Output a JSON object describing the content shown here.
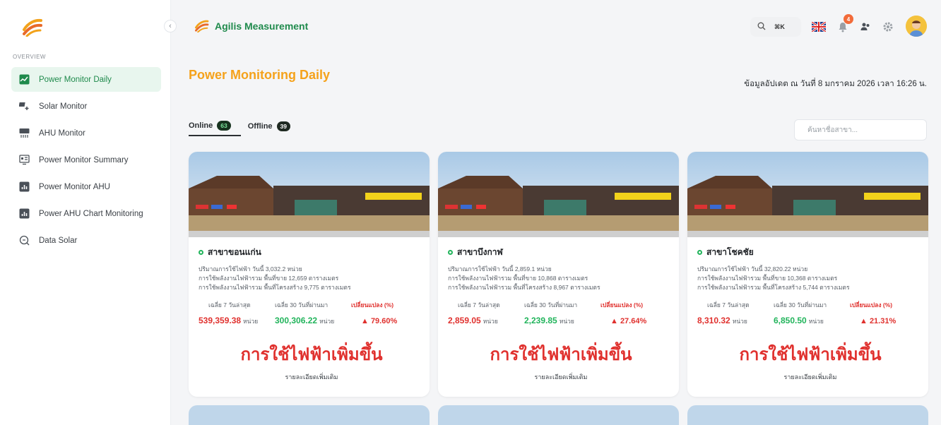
{
  "sidebar": {
    "section": "OVERVIEW",
    "items": [
      {
        "label": "Power Monitor Daily",
        "icon": "chart-icon",
        "active": true
      },
      {
        "label": "Solar Monitor",
        "icon": "solar-icon"
      },
      {
        "label": "AHU Monitor",
        "icon": "ac-icon"
      },
      {
        "label": "Power Monitor Summary",
        "icon": "summary-icon"
      },
      {
        "label": "Power Monitor AHU",
        "icon": "bar-chart-icon"
      },
      {
        "label": "Power AHU Chart Monitoring",
        "icon": "bar-chart-icon"
      },
      {
        "label": "Data Solar",
        "icon": "data-icon"
      }
    ]
  },
  "header": {
    "brand": "Agilis Measurement",
    "shortcut": "⌘K",
    "notification_count": "4"
  },
  "page": {
    "title": "Power Monitoring Daily",
    "updated": "ข้อมูลอัปเดต ณ วันที่ 8 มกราคม 2026 เวลา 16:26 น.",
    "search_placeholder": "ค้นหาชื่อสาขา..."
  },
  "tabs": [
    {
      "label": "Online",
      "count": "63"
    },
    {
      "label": "Offline",
      "count": "39"
    }
  ],
  "labels": {
    "avg7": "เฉลี่ย 7 วันล่าสุด",
    "avg30": "เฉลี่ย 30 วันที่ผ่านมา",
    "change": "เปลี่ยนแปลง (%)",
    "unit": "หน่วย",
    "status": "การใช้ไฟฟ้าเพิ่มขึ้น",
    "detail": "รายละเอียดเพิ่มเติม"
  },
  "cards": [
    {
      "name": "สาขาขอนแก่น",
      "usage": "ปริมาณการใช้ไฟฟ้า วันนี้ 3,032.2 หน่วย",
      "sales_area": "การใช้พลังงานไฟฟ้ารวม พื้นที่ขาย 12,659 ตารางเมตร",
      "structure_area": "การใช้พลังงานไฟฟ้ารวม พื้นที่โครงสร้าง 9,775 ตารางเมตร",
      "avg7": "539,359.38",
      "avg30": "300,306.22",
      "change": "▲ 79.60%"
    },
    {
      "name": "สาขาบึงกาฬ",
      "usage": "ปริมาณการใช้ไฟฟ้า วันนี้ 2,859.1 หน่วย",
      "sales_area": "การใช้พลังงานไฟฟ้ารวม พื้นที่ขาย 10,868 ตารางเมตร",
      "structure_area": "การใช้พลังงานไฟฟ้ารวม พื้นที่โครงสร้าง 8,967 ตารางเมตร",
      "avg7": "2,859.05",
      "avg30": "2,239.85",
      "change": "▲ 27.64%"
    },
    {
      "name": "สาขาโชคชัย",
      "usage": "ปริมาณการใช้ไฟฟ้า วันนี้ 32,820.22 หน่วย",
      "sales_area": "การใช้พลังงานไฟฟ้ารวม พื้นที่ขาย 10,368 ตารางเมตร",
      "structure_area": "การใช้พลังงานไฟฟ้ารวม พื้นที่โครงสร้าง 5,744 ตารางเมตร",
      "avg7": "8,310.32",
      "avg30": "6,850.50",
      "change": "▲ 21.31%"
    }
  ],
  "colors": {
    "accent": "#f5a21b",
    "brand": "#1f8a4c",
    "increase": "#e0312e",
    "online": "#21b45b"
  }
}
